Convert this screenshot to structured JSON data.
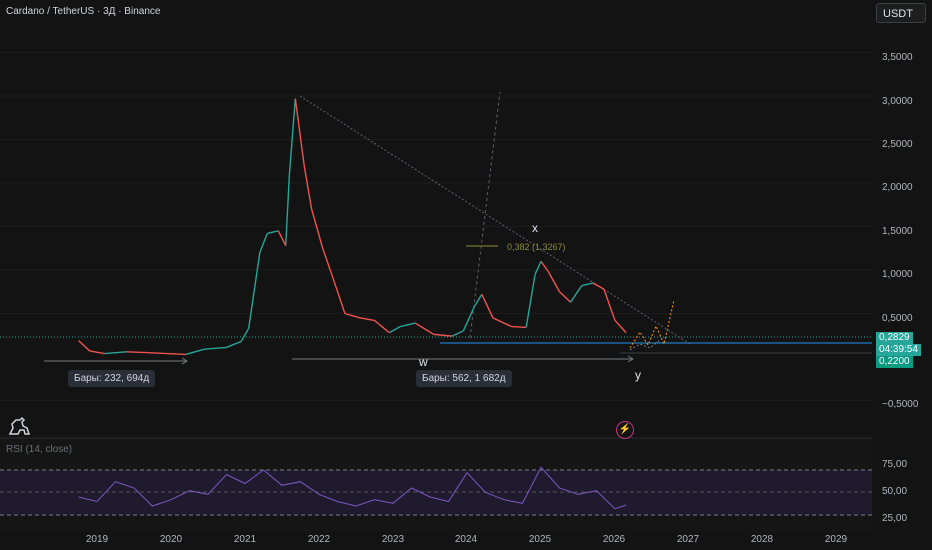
{
  "header": {
    "symbol": "Cardano / TetherUS · 3Д · Binance",
    "currency_button": "USDT"
  },
  "price_axis": {
    "labels": [
      "3,5000",
      "3,0000",
      "2,5000",
      "2,0000",
      "1,5000",
      "1,0000",
      "0,5000",
      "−0,5000"
    ]
  },
  "price_tags": {
    "current": "0,2829",
    "countdown": "04:39:54",
    "level": "0,2200",
    "current_color": "#26a69a",
    "level_color": "#089981"
  },
  "time_axis": {
    "labels": [
      "2019",
      "2020",
      "2021",
      "2022",
      "2023",
      "2024",
      "2025",
      "2026",
      "2027",
      "2028",
      "2029"
    ]
  },
  "annotations": {
    "range1": "Бары: 232, 694д",
    "range2": "Бары: 562, 1 682д",
    "wave_w": "w",
    "wave_x": "x",
    "wave_y": "y",
    "fib": "0,382 (1,3267)"
  },
  "rsi": {
    "title": "RSI (14, close)",
    "labels": [
      "75,00",
      "50,00",
      "25,00"
    ]
  },
  "icons": {
    "logo": "tradingview-dino-icon",
    "alert": "lightning-icon"
  },
  "chart_data": [
    {
      "type": "line",
      "title": "Cardano / TetherUS · 3Д · Binance",
      "ylim": [
        -0.6,
        3.9
      ],
      "series": [
        {
          "x": [
            2018.75,
            2018.9,
            2019.1,
            2019.4,
            2019.7,
            2019.95,
            2020.2,
            2020.45,
            2020.75,
            2020.95,
            2021.05,
            2021.2,
            2021.3,
            2021.45,
            2021.55,
            2021.6,
            2021.68,
            2021.8,
            2021.9,
            2022.05,
            2022.2,
            2022.35,
            2022.55,
            2022.75,
            2022.95,
            2023.1,
            2023.3,
            2023.55,
            2023.8,
            2023.95,
            2024.1,
            2024.2,
            2024.35,
            2024.6,
            2024.8,
            2024.92,
            2025.0,
            2025.1,
            2025.25,
            2025.4,
            2025.55,
            2025.7,
            2025.85,
            2026.0,
            2026.15
          ],
          "values": [
            0.19,
            0.07,
            0.04,
            0.06,
            0.05,
            0.04,
            0.03,
            0.09,
            0.11,
            0.18,
            0.33,
            1.2,
            1.42,
            1.45,
            1.28,
            2.1,
            2.97,
            2.2,
            1.7,
            1.25,
            0.88,
            0.5,
            0.45,
            0.42,
            0.28,
            0.35,
            0.39,
            0.26,
            0.24,
            0.3,
            0.58,
            0.72,
            0.45,
            0.35,
            0.34,
            0.95,
            1.1,
            0.98,
            0.75,
            0.63,
            0.82,
            0.85,
            0.78,
            0.42,
            0.28
          ]
        }
      ]
    },
    {
      "type": "line",
      "title": "RSI (14, close)",
      "ylim": [
        20,
        85
      ],
      "series": [
        {
          "x": [
            2018.75,
            2019.0,
            2019.25,
            2019.5,
            2019.75,
            2020.0,
            2020.25,
            2020.5,
            2020.75,
            2021.0,
            2021.25,
            2021.5,
            2021.75,
            2022.0,
            2022.25,
            2022.5,
            2022.75,
            2023.0,
            2023.25,
            2023.5,
            2023.75,
            2024.0,
            2024.25,
            2024.5,
            2024.75,
            2025.0,
            2025.25,
            2025.5,
            2025.75,
            2026.0,
            2026.15
          ],
          "values": [
            45,
            40,
            62,
            55,
            35,
            42,
            52,
            48,
            70,
            60,
            75,
            58,
            62,
            48,
            40,
            35,
            42,
            38,
            55,
            45,
            40,
            72,
            50,
            42,
            38,
            78,
            55,
            48,
            52,
            32,
            36
          ]
        }
      ]
    }
  ]
}
